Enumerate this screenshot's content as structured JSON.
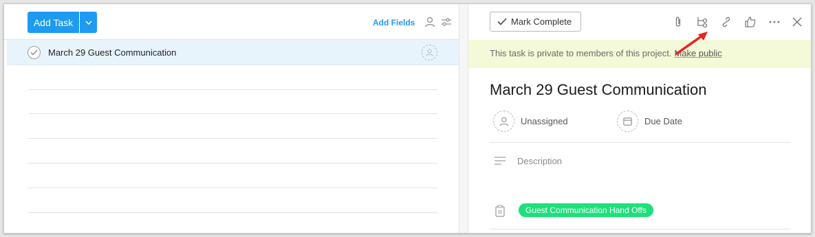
{
  "toolbar": {
    "add_task_label": "Add Task",
    "add_fields_label": "Add Fields"
  },
  "task_list": {
    "selected_task": "March 29 Guest Communication"
  },
  "detail": {
    "mark_complete_label": "Mark Complete",
    "private_notice": "This task is private to members of this project.",
    "make_public_label": "Make public",
    "title": "March 29 Guest Communication",
    "assignee_label": "Unassigned",
    "due_date_label": "Due Date",
    "description_placeholder": "Description",
    "project_tag": "Guest Communication Hand Offs"
  },
  "colors": {
    "accent": "#1d9bf0",
    "banner": "#f4f9d8",
    "tag": "#1ee07a",
    "annotation_arrow": "#e8231f"
  },
  "icons": [
    "chevron-down-icon",
    "person-icon",
    "sliders-icon",
    "check-icon",
    "paperclip-icon",
    "subtask-icon",
    "link-icon",
    "thumbs-up-icon",
    "more-icon",
    "close-icon",
    "calendar-icon",
    "description-icon",
    "clipboard-icon"
  ]
}
